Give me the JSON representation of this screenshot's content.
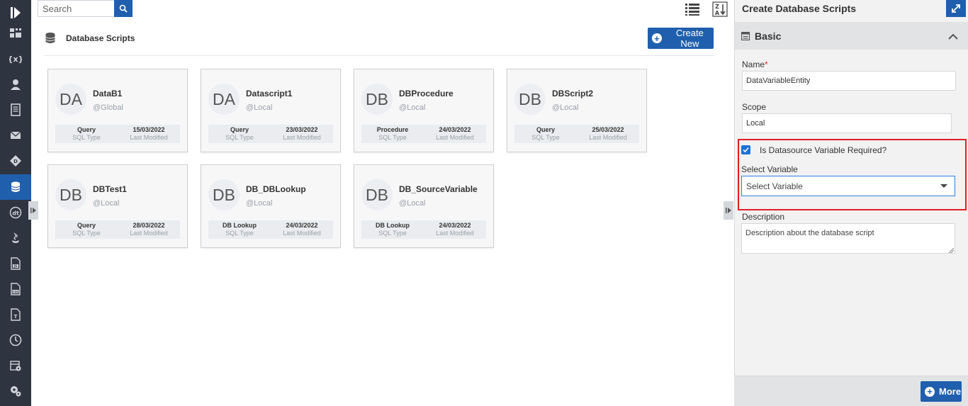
{
  "search": {
    "placeholder": "Search"
  },
  "header": {
    "title": "Database Scripts",
    "create_label": "Create New"
  },
  "cards": [
    {
      "initials": "DA",
      "name": "DataB1",
      "scope": "@Global",
      "type": "Query",
      "type_label": "SQL Type",
      "date": "15/03/2022",
      "date_label": "Last Modified"
    },
    {
      "initials": "DA",
      "name": "Datascript1",
      "scope": "@Local",
      "type": "Query",
      "type_label": "SQL Type",
      "date": "23/03/2022",
      "date_label": "Last Modified"
    },
    {
      "initials": "DB",
      "name": "DBProcedure",
      "scope": "@Local",
      "type": "Procedure",
      "type_label": "SQL Type",
      "date": "24/03/2022",
      "date_label": "Last Modified"
    },
    {
      "initials": "DB",
      "name": "DBScript2",
      "scope": "@Local",
      "type": "Query",
      "type_label": "SQL Type",
      "date": "25/03/2022",
      "date_label": "Last Modified"
    },
    {
      "initials": "DB",
      "name": "DBTest1",
      "scope": "@Local",
      "type": "Query",
      "type_label": "SQL Type",
      "date": "28/03/2022",
      "date_label": "Last Modified"
    },
    {
      "initials": "DB",
      "name": "DB_DBLookup",
      "scope": "@Local",
      "type": "DB Lookup",
      "type_label": "SQL Type",
      "date": "24/03/2022",
      "date_label": "Last Modified"
    },
    {
      "initials": "DB",
      "name": "DB_SourceVariable",
      "scope": "@Local",
      "type": "DB Lookup",
      "type_label": "SQL Type",
      "date": "24/03/2022",
      "date_label": "Last Modified"
    }
  ],
  "panel": {
    "title": "Create Database Scripts",
    "section": "Basic",
    "name_label": "Name",
    "required_mark": "*",
    "name_value": "DataVariableEntity",
    "scope_label": "Scope",
    "scope_value": "Local",
    "checkbox_label": "Is Datasource Variable Required?",
    "checkbox_checked": true,
    "select_label": "Select Variable",
    "select_placeholder": "Select Variable",
    "description_label": "Description",
    "description_placeholder": "Description about the database script",
    "more_label": "More"
  },
  "icons": {
    "rail": [
      "logo-icon",
      "dashboard-icon",
      "variable-icon",
      "user-icon",
      "document-icon",
      "mail-icon",
      "decision-icon",
      "database-icon",
      "datatype-icon",
      "java-icon",
      "js-file-icon",
      "css-file-icon",
      "text-file-icon",
      "clock-icon",
      "calendar-settings-icon",
      "settings-icon"
    ]
  },
  "colors": {
    "accent": "#1f5fad",
    "rail": "#2e3440",
    "highlight": "#e01f26",
    "checkbox": "#1f6fd9"
  }
}
